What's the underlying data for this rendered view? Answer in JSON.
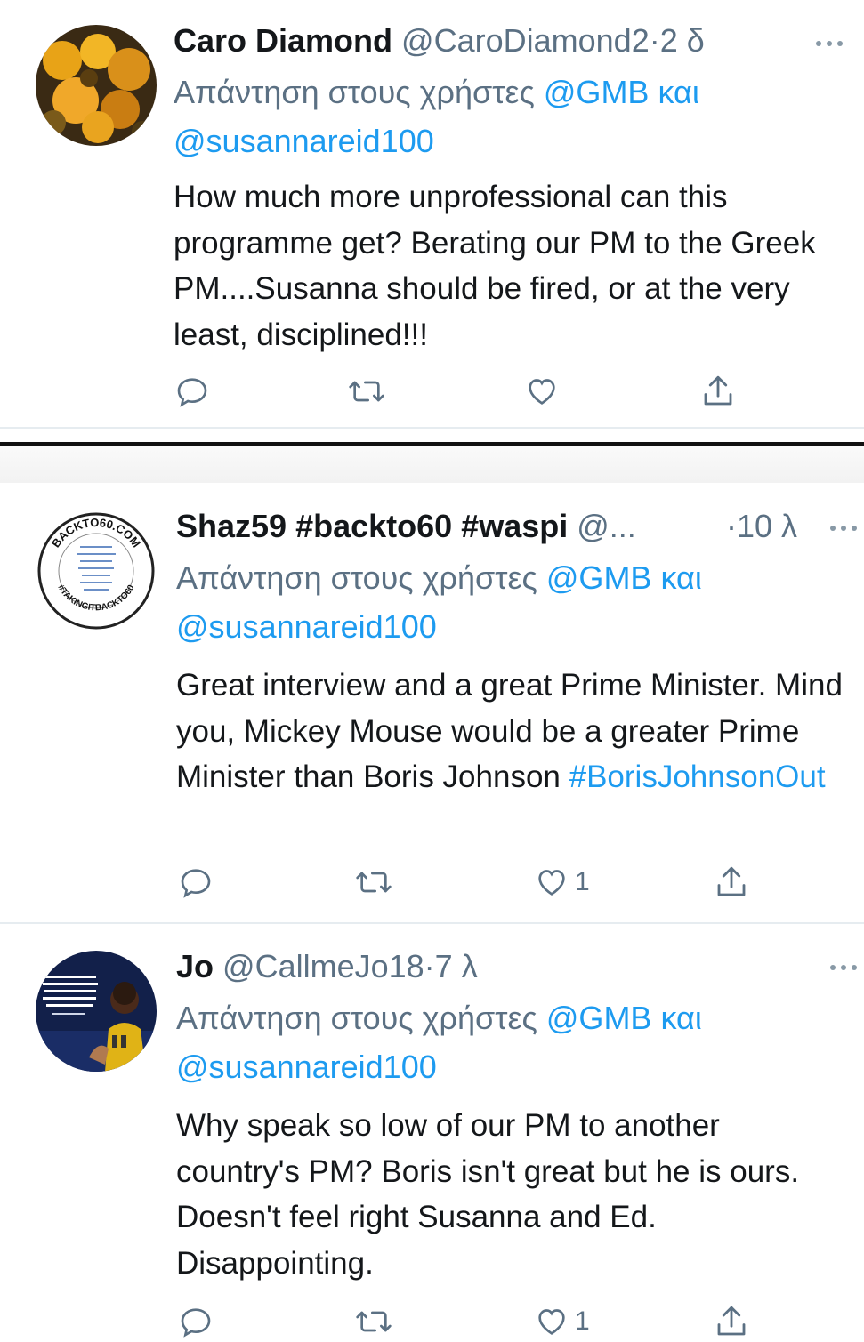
{
  "tweets": [
    {
      "name": "Caro Diamond",
      "handle": "@CaroDiamond2",
      "sep": "·",
      "time": "2 δ",
      "reply_prefix": "Απάντηση στους χρήστες",
      "mention1": "@GMB",
      "reply_and": "και",
      "mention2": "@susannareid100",
      "text": "How much more unprofessional can this programme get? Berating our PM to the Greek PM....Susanna should be fired, or at the very least, disciplined!!!",
      "like_count": ""
    },
    {
      "name": "Shaz59 #backto60 #waspi",
      "handle": "@...",
      "sep": "·",
      "time": "10 λ",
      "reply_prefix": "Απάντηση στους χρήστες",
      "mention1": "@GMB",
      "reply_and": "και",
      "mention2": "@susannareid100",
      "text": "Great interview and a great Prime Minister. Mind you, Mickey Mouse would be a greater Prime Minister than Boris Johnson",
      "hashtag": "#BorisJohnsonOut",
      "like_count": "1",
      "avatar_text_top": "BACKTO60.COM",
      "avatar_text_bottom": "#TAKINGITBACKTO60"
    },
    {
      "name": "Jo",
      "handle": "@CallmeJo18",
      "sep": "·",
      "time": "7 λ",
      "reply_prefix": "Απάντηση στους χρήστες",
      "mention1": "@GMB",
      "reply_and": "και",
      "mention2": "@susannareid100",
      "text": "Why speak so low of our PM to another country's PM? Boris isn't great but he is ours. Doesn't feel right Susanna and Ed. Disappointing.",
      "like_count": "1"
    }
  ],
  "icons": {
    "reply": "reply-icon",
    "retweet": "retweet-icon",
    "like": "like-icon",
    "share": "share-icon",
    "more": "more-icon"
  },
  "colors": {
    "link": "#1d9bf0",
    "secondary": "#5b7083",
    "text": "#14171a"
  }
}
